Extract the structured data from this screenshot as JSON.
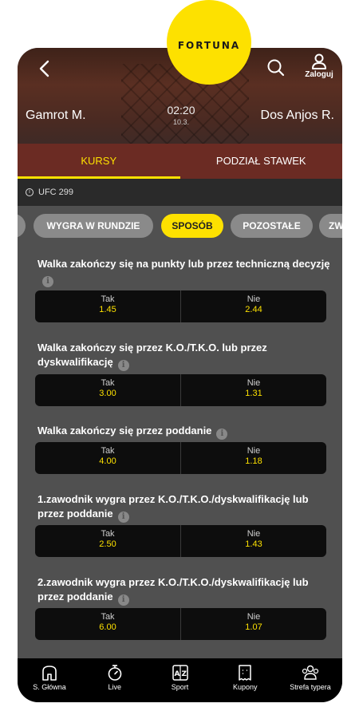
{
  "brand": {
    "logo_text": "FORTUNA",
    "logo_color": "#fde100"
  },
  "header": {
    "login_label": "Zaloguj",
    "home_team": "Gamrot M.",
    "away_team": "Dos Anjos R.",
    "time": "02:20",
    "date": "10.3."
  },
  "tabs": [
    {
      "label": "KURSY",
      "active": true
    },
    {
      "label": "PODZIAŁ STAWEK",
      "active": false
    }
  ],
  "event": {
    "name": "UFC 299"
  },
  "chips": [
    {
      "label": ""
    },
    {
      "label": "WYGRA W RUNDZIE"
    },
    {
      "label": "SPOSÓB",
      "active": true
    },
    {
      "label": "POZOSTAŁE"
    },
    {
      "label": "ZW"
    }
  ],
  "markets": [
    {
      "title": "Walka zakończy się na punkty lub przez techniczną decyzję",
      "odds": [
        {
          "name": "Tak",
          "value": "1.45"
        },
        {
          "name": "Nie",
          "value": "2.44"
        }
      ]
    },
    {
      "title": "Walka zakończy się przez K.O./T.K.O. lub przez dyskwalifikację",
      "odds": [
        {
          "name": "Tak",
          "value": "3.00"
        },
        {
          "name": "Nie",
          "value": "1.31"
        }
      ]
    },
    {
      "title": "Walka zakończy się przez poddanie",
      "odds": [
        {
          "name": "Tak",
          "value": "4.00"
        },
        {
          "name": "Nie",
          "value": "1.18"
        }
      ]
    },
    {
      "title": "1.zawodnik wygra przez K.O./T.K.O./dyskwalifikację lub przez poddanie",
      "odds": [
        {
          "name": "Tak",
          "value": "2.50"
        },
        {
          "name": "Nie",
          "value": "1.43"
        }
      ]
    },
    {
      "title": "2.zawodnik wygra przez K.O./T.K.O./dyskwalifikację lub przez poddanie",
      "odds": [
        {
          "name": "Tak",
          "value": "6.00"
        },
        {
          "name": "Nie",
          "value": "1.07"
        }
      ]
    }
  ],
  "bottom_nav": [
    {
      "label": "S. Główna",
      "icon": "home-icon"
    },
    {
      "label": "Live",
      "icon": "stopwatch-icon"
    },
    {
      "label": "Sport",
      "icon": "az-icon"
    },
    {
      "label": "Kupony",
      "icon": "ticket-icon"
    },
    {
      "label": "Strefa typera",
      "icon": "users-icon"
    }
  ],
  "colors": {
    "accent": "#fde100",
    "header_bg": "#6b2b23",
    "content_bg": "#505050"
  }
}
